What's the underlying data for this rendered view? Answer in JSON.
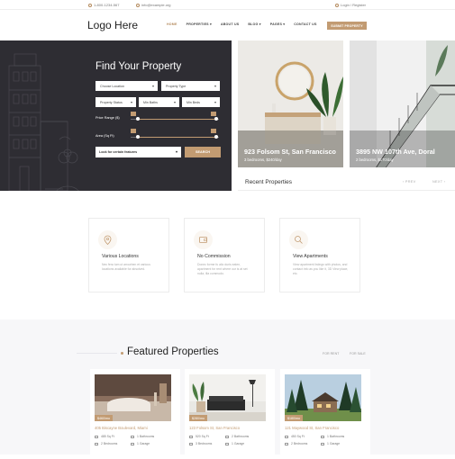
{
  "topbar": {
    "phone": "1-800-1234-567",
    "email": "info@example.org",
    "login": "Login / Register"
  },
  "header": {
    "logo": "Logo Here",
    "nav": [
      "HOME",
      "PROPERTIES",
      "ABOUT US",
      "BLOG",
      "PAGES",
      "CONTACT US"
    ],
    "submit": "SUBMIT PROPERTY"
  },
  "hero": {
    "title": "Find Your Property",
    "location_placeholder": "Choose Location",
    "type_placeholder": "Property Type",
    "status_placeholder": "Property Status",
    "baths_placeholder": "Min Baths",
    "beds_placeholder": "Min Beds",
    "price_label": "Price Range ($)",
    "area_label": "Area (Sq Ft)",
    "features": "Look for certain features",
    "search": "SEARCH",
    "price_range": [
      0.08,
      0.97
    ],
    "area_range": [
      0.08,
      0.97
    ]
  },
  "top_properties": [
    {
      "address": "923 Folsom St, San Francisco",
      "meta": "3 bedrooms, $240/day"
    },
    {
      "address": "3895 NW 107th Ave, Doral",
      "meta": "2 bedrooms, $170/day"
    }
  ],
  "recent": {
    "title": "Recent Properties",
    "prev": "‹ PREV",
    "next": "NEXT ›"
  },
  "features": [
    {
      "icon": "location-pin-icon",
      "title": "Various Locations",
      "desc": "Nec fera tum ut arrowhen et various locations available for absolved."
    },
    {
      "icon": "wallet-icon",
      "title": "No Commission",
      "desc": "Donec forme fu alio duris eaten, apartment for rent where our is at set nulla, illa commodo."
    },
    {
      "icon": "search-icon",
      "title": "View Apartments",
      "desc": "View apartment listings with photos, and contact info as you like it, 3D View place, etc."
    }
  ],
  "featured": {
    "title": "Featured Properties",
    "tab_rent": "FOR RENT",
    "tab_sale": "FOR SALE"
  },
  "listings": [
    {
      "price": "$460/mo",
      "address": "405 Biscayne Boulevard, Miami",
      "area": "485 Sq Ft",
      "baths": "1 Bathrooms",
      "beds": "2 Bedrooms",
      "garage": "1 Garage"
    },
    {
      "price": "$280/mo",
      "address": "123 Folsom St, San Francisco",
      "area": "520 Sq Ft",
      "baths": "2 Bathrooms",
      "beds": "3 Bedrooms",
      "garage": "1 Garage"
    },
    {
      "price": "$180/mo",
      "address": "121 Maywood St, San Francisco",
      "area": "450 Sq Ft",
      "baths": "1 Bathrooms",
      "beds": "2 Bedrooms",
      "garage": "1 Garage"
    }
  ],
  "colors": {
    "accent": "#c29b72",
    "hero_bg": "#2e2d33"
  }
}
